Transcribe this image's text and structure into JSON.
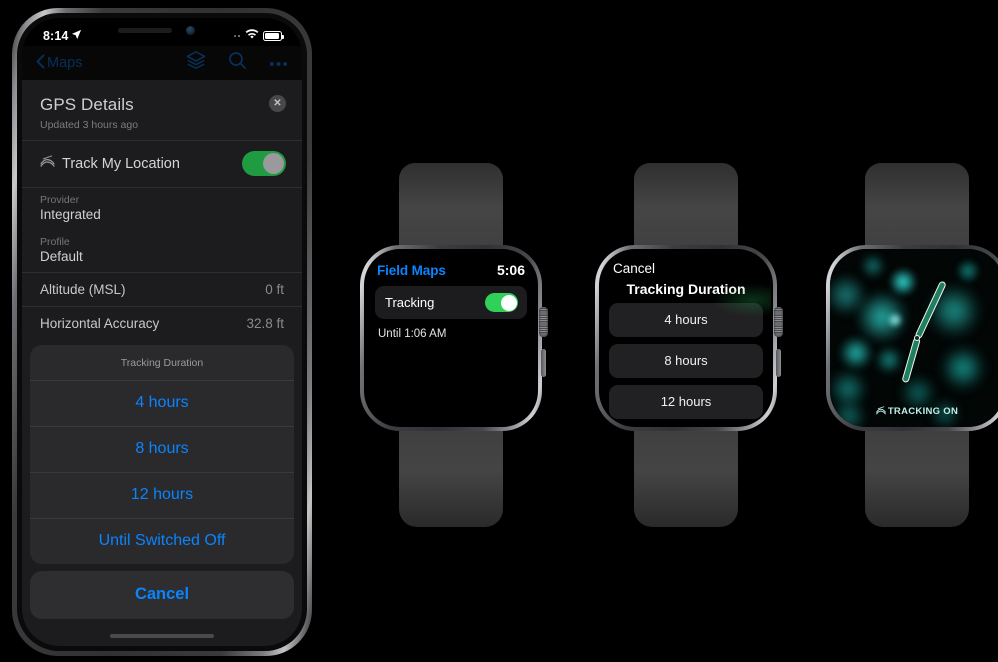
{
  "phone": {
    "status_bar": {
      "time": "8:14",
      "location_icon": "location-arrow-icon",
      "cellular_icon": "cellular-dots-icon",
      "wifi_icon": "wifi-icon",
      "battery_icon": "battery-icon"
    },
    "nav_bar": {
      "back_label": "Maps",
      "back_icon": "chevron-left-icon",
      "layers_icon": "layers-icon",
      "search_icon": "search-icon",
      "more_icon": "ellipsis-icon"
    },
    "gps_panel": {
      "title": "GPS Details",
      "subtitle": "Updated 3 hours ago",
      "close_icon": "close-circle-icon",
      "track_row": {
        "icon": "location-track-icon",
        "label": "Track My Location",
        "toggle_on": true
      },
      "fields": [
        {
          "key": "Provider",
          "value": "Integrated"
        },
        {
          "key": "Profile",
          "value": "Default"
        }
      ],
      "metrics": [
        {
          "key": "Altitude (MSL)",
          "value": "0 ft"
        },
        {
          "key": "Horizontal Accuracy",
          "value": "32.8 ft"
        }
      ]
    },
    "action_sheet": {
      "title": "Tracking Duration",
      "options": [
        "4 hours",
        "8 hours",
        "12 hours",
        "Until Switched Off"
      ],
      "cancel_label": "Cancel"
    }
  },
  "watch_tracking": {
    "app_name": "Field Maps",
    "time": "5:06",
    "row_label": "Tracking",
    "toggle_on": true,
    "until_text": "Until 1:06 AM"
  },
  "watch_duration": {
    "cancel_label": "Cancel",
    "title": "Tracking Duration",
    "options": [
      "4 hours",
      "8 hours",
      "12 hours"
    ]
  },
  "watch_face": {
    "complication_text": "TRACKING ON",
    "complication_icon": "location-track-icon",
    "hour_hand_angle": 25,
    "minute_hand_angle": 196
  },
  "colors": {
    "accent_blue": "#0a84ff",
    "toggle_green": "#30d158",
    "phone_toggle_green": "#1f9c41",
    "face_teal": "#1fb6b0",
    "hand_green": "#1f7f5e"
  }
}
